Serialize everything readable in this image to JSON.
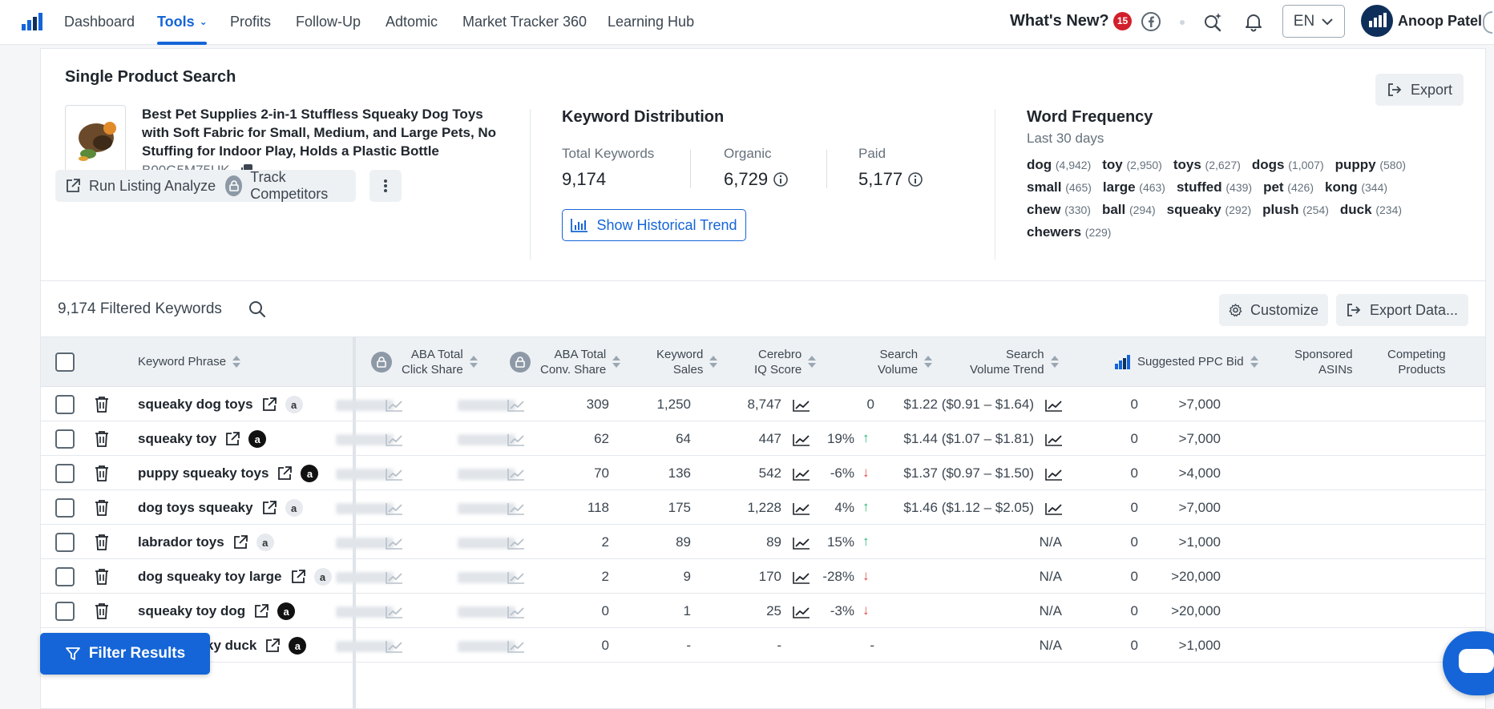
{
  "nav": {
    "items": [
      "Dashboard",
      "Tools",
      "Profits",
      "Follow-Up",
      "Adtomic",
      "Market Tracker 360",
      "Learning Hub"
    ],
    "active": "Tools",
    "whats_new": "What's New?",
    "badge_count": "15",
    "language": "EN",
    "user_name": "Anoop Patel"
  },
  "product": {
    "section_title": "Single Product Search",
    "export_label": "Export",
    "name": "Best Pet Supplies 2-in-1 Stuffless Squeaky Dog Toys with Soft Fabric for Small, Medium, and Large Pets, No Stuffing for Indoor Play, Holds a Plastic Bottle",
    "asin": "B00G5M75UK",
    "run_listing_label": "Run Listing Analyzer",
    "track_competitors_label": "Track Competitors"
  },
  "distribution": {
    "title": "Keyword Distribution",
    "total_label": "Total Keywords",
    "total_value": "9,174",
    "organic_label": "Organic",
    "organic_value": "6,729",
    "paid_label": "Paid",
    "paid_value": "5,177",
    "history_label": "Show Historical Trend"
  },
  "word_frequency": {
    "title": "Word Frequency",
    "subtitle": "Last 30 days",
    "words": [
      {
        "word": "dog",
        "count": "(4,942)"
      },
      {
        "word": "toy",
        "count": "(2,950)"
      },
      {
        "word": "toys",
        "count": "(2,627)"
      },
      {
        "word": "dogs",
        "count": "(1,007)"
      },
      {
        "word": "puppy",
        "count": "(580)"
      },
      {
        "word": "small",
        "count": "(465)"
      },
      {
        "word": "large",
        "count": "(463)"
      },
      {
        "word": "stuffed",
        "count": "(439)"
      },
      {
        "word": "pet",
        "count": "(426)"
      },
      {
        "word": "kong",
        "count": "(344)"
      },
      {
        "word": "chew",
        "count": "(330)"
      },
      {
        "word": "ball",
        "count": "(294)"
      },
      {
        "word": "squeaky",
        "count": "(292)"
      },
      {
        "word": "plush",
        "count": "(254)"
      },
      {
        "word": "duck",
        "count": "(234)"
      },
      {
        "word": "chewers",
        "count": "(229)"
      }
    ]
  },
  "filter_bar": {
    "filtered_label": "9,174 Filtered Keywords",
    "customize_label": "Customize",
    "export_data_label": "Export Data..."
  },
  "table": {
    "headers": {
      "keyword": "Keyword Phrase",
      "aba_click_1": "ABA Total",
      "aba_click_2": "Click Share",
      "aba_conv_1": "ABA Total",
      "aba_conv_2": "Conv. Share",
      "kw_sales_1": "Keyword",
      "kw_sales_2": "Sales",
      "iq_1": "Cerebro",
      "iq_2": "IQ Score",
      "sv_1": "Search",
      "sv_2": "Volume",
      "svt_1": "Search",
      "svt_2": "Volume Trend",
      "ppc": "Suggested PPC Bid",
      "sponsored_1": "Sponsored",
      "sponsored_2": "ASINs",
      "competing_1": "Competing",
      "competing_2": "Products"
    },
    "rows": [
      {
        "keyword": "squeaky dog toys",
        "amazon_icon": "light",
        "keyword_sales": "309",
        "iq_score": "1,250",
        "search_volume": "8,747",
        "trend": "0",
        "trend_dir": "none",
        "ppc": "$1.22",
        "ppc_range": "($0.91 – $1.64)",
        "sponsored": "0",
        "competing": ">7,000"
      },
      {
        "keyword": "squeaky toy",
        "amazon_icon": "dark",
        "keyword_sales": "62",
        "iq_score": "64",
        "search_volume": "447",
        "trend": "19%",
        "trend_dir": "up",
        "ppc": "$1.44",
        "ppc_range": "($1.07 – $1.81)",
        "sponsored": "0",
        "competing": ">7,000"
      },
      {
        "keyword": "puppy squeaky toys",
        "amazon_icon": "dark",
        "keyword_sales": "70",
        "iq_score": "136",
        "search_volume": "542",
        "trend": "-6%",
        "trend_dir": "down",
        "ppc": "$1.37",
        "ppc_range": "($0.97 – $1.50)",
        "sponsored": "0",
        "competing": ">4,000"
      },
      {
        "keyword": "dog toys squeaky",
        "amazon_icon": "light",
        "keyword_sales": "118",
        "iq_score": "175",
        "search_volume": "1,228",
        "trend": "4%",
        "trend_dir": "up",
        "ppc": "$1.46",
        "ppc_range": "($1.12 – $2.05)",
        "sponsored": "0",
        "competing": ">7,000"
      },
      {
        "keyword": "labrador toys",
        "amazon_icon": "light",
        "keyword_sales": "2",
        "iq_score": "89",
        "search_volume": "89",
        "trend": "15%",
        "trend_dir": "up",
        "ppc": "N/A",
        "ppc_range": "",
        "sponsored": "0",
        "competing": ">1,000"
      },
      {
        "keyword": "dog squeaky toy large",
        "amazon_icon": "light",
        "keyword_sales": "2",
        "iq_score": "9",
        "search_volume": "170",
        "trend": "-28%",
        "trend_dir": "down",
        "ppc": "N/A",
        "ppc_range": "",
        "sponsored": "0",
        "competing": ">20,000"
      },
      {
        "keyword": "squeaky toy dog",
        "amazon_icon": "dark",
        "keyword_sales": "0",
        "iq_score": "1",
        "search_volume": "25",
        "trend": "-3%",
        "trend_dir": "down",
        "ppc": "N/A",
        "ppc_range": "",
        "sponsored": "0",
        "competing": ">20,000"
      },
      {
        "keyword": "dog squeaky duck",
        "amazon_icon": "dark",
        "keyword_sales": "0",
        "iq_score": "-",
        "search_volume": "-",
        "trend": "-",
        "trend_dir": "none",
        "ppc": "N/A",
        "ppc_range": "",
        "sponsored": "0",
        "competing": ">1,000"
      }
    ]
  },
  "filter_results_label": "Filter Results",
  "colors": {
    "accent": "#1565d8",
    "trend_up": "#22b573",
    "trend_down": "#e04343",
    "badge": "#d21f2b"
  },
  "icons": [
    "helium10-logo",
    "chevron-down-icon",
    "facebook-icon",
    "sparkle-search-icon",
    "bell-icon",
    "export-icon",
    "copy-icon",
    "external-link-icon",
    "lock-icon",
    "kebab-menu-icon",
    "bar-chart-icon",
    "info-icon",
    "search-icon",
    "gear-icon",
    "trash-icon",
    "amazon-icon",
    "sparkline-icon",
    "filter-icon",
    "chat-icon"
  ]
}
